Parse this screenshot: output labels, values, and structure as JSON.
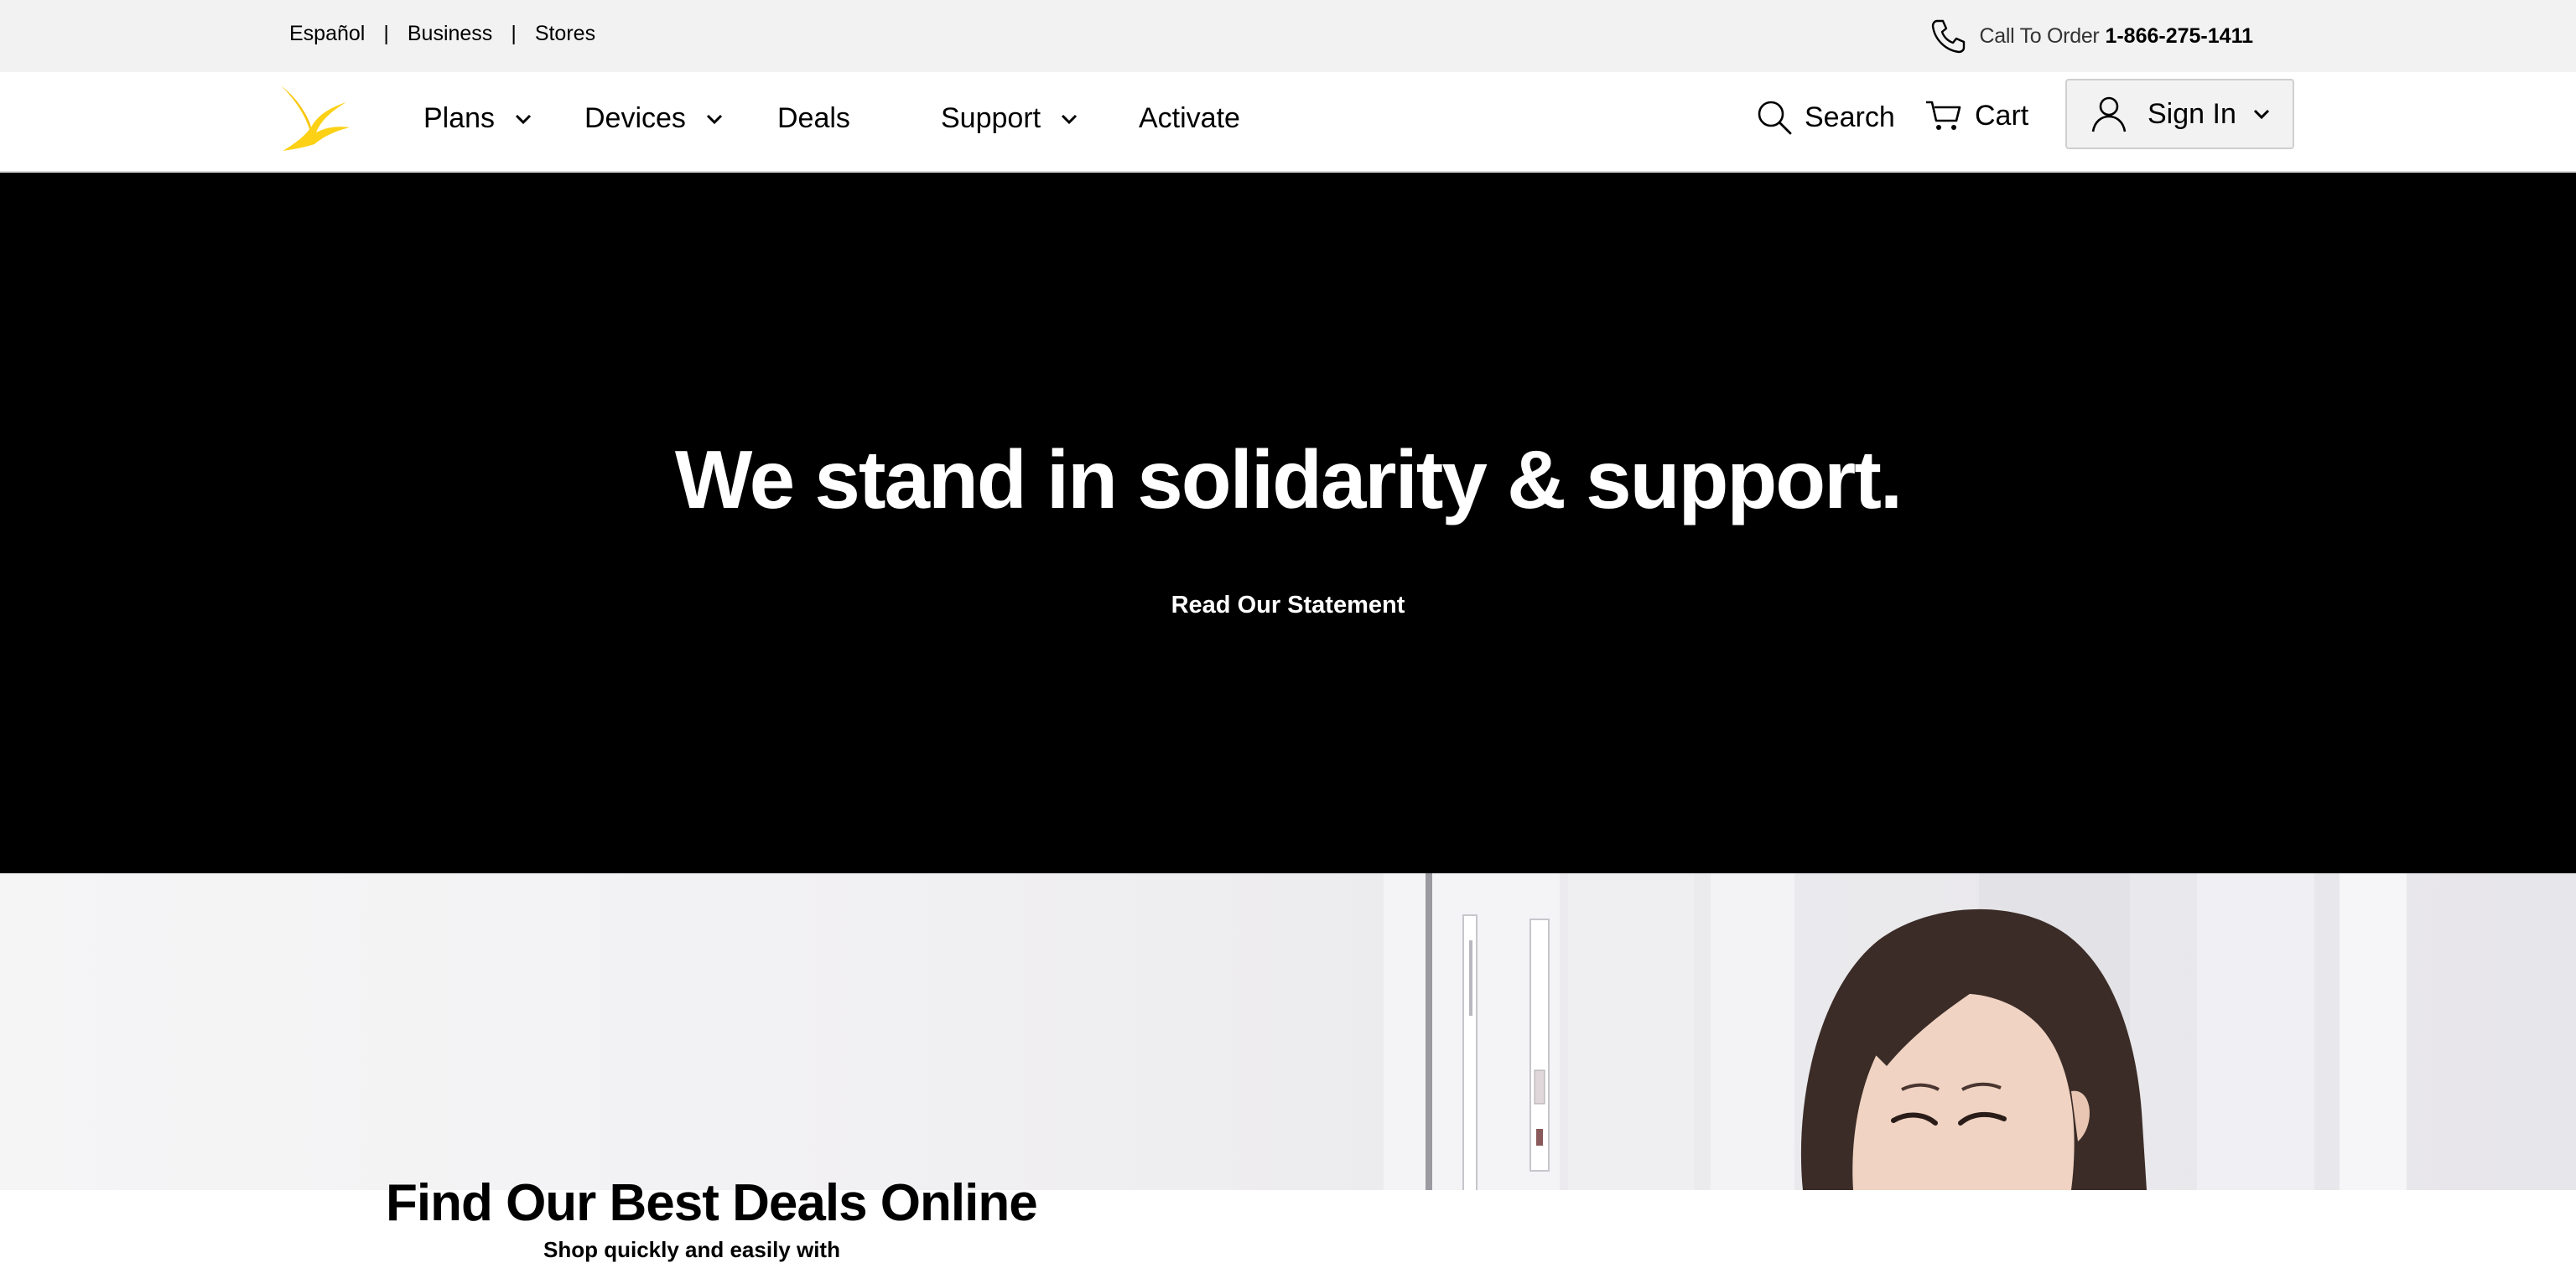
{
  "utility_bar": {
    "links": [
      "Español",
      "Business",
      "Stores"
    ],
    "separator": "|",
    "call_lead": "Call To Order",
    "call_number": "1-866-275-1411"
  },
  "nav": {
    "items": {
      "plans": "Plans",
      "devices": "Devices",
      "deals": "Deals",
      "support": "Support",
      "activate": "Activate"
    },
    "search": "Search",
    "cart": "Cart",
    "sign_in": "Sign In"
  },
  "hero": {
    "headline": "We stand in solidarity & support.",
    "cta": "Read Our Statement"
  },
  "deals": {
    "title": "Find Our Best Deals Online",
    "subtitle": "Shop quickly and easily with"
  },
  "colors": {
    "brand_yellow": "#fcd116",
    "hero_bg": "#000000",
    "utility_bg": "#f2f2f2"
  },
  "icons": [
    "phone-icon",
    "sprint-logo",
    "chevron-down-icon",
    "search-icon",
    "cart-icon",
    "user-icon"
  ]
}
